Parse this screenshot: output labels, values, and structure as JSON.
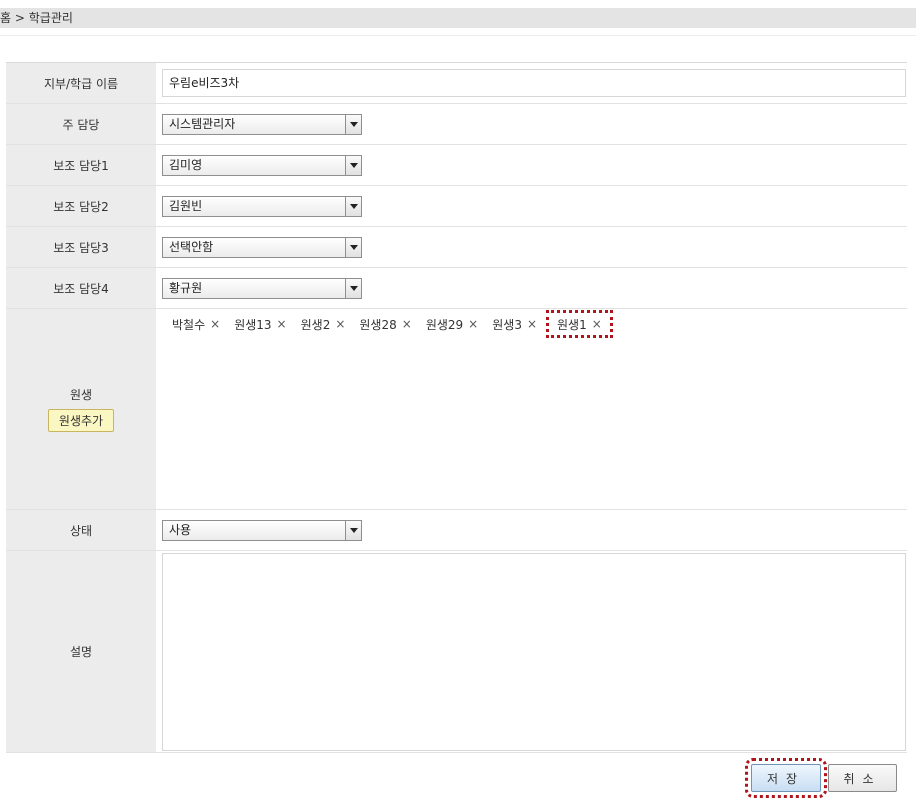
{
  "breadcrumb": {
    "home": "홈",
    "separator": ">",
    "current": "학급관리"
  },
  "form": {
    "name": {
      "label": "지부/학급 이름",
      "value": "우림e비즈3차"
    },
    "main_manager": {
      "label": "주 담당",
      "value": "시스템관리자"
    },
    "sub_manager1": {
      "label": "보조 담당1",
      "value": "김미영"
    },
    "sub_manager2": {
      "label": "보조 담당2",
      "value": "김원빈"
    },
    "sub_manager3": {
      "label": "보조 담당3",
      "value": "선택안함"
    },
    "sub_manager4": {
      "label": "보조 담당4",
      "value": "황규원"
    },
    "students": {
      "label": "원생",
      "add_label": "원생추가",
      "items": [
        "박철수",
        "원생13",
        "원생2",
        "원생28",
        "원생29",
        "원생3",
        "원생1"
      ],
      "remove_icon": "×"
    },
    "status": {
      "label": "상태",
      "value": "사용"
    },
    "description": {
      "label": "설명",
      "value": ""
    }
  },
  "buttons": {
    "save": "저장",
    "cancel": "취소"
  },
  "colors": {
    "highlight_outline": "#b0141c",
    "label_bg": "#ececec",
    "add_button_bg": "#fbf7c2"
  }
}
